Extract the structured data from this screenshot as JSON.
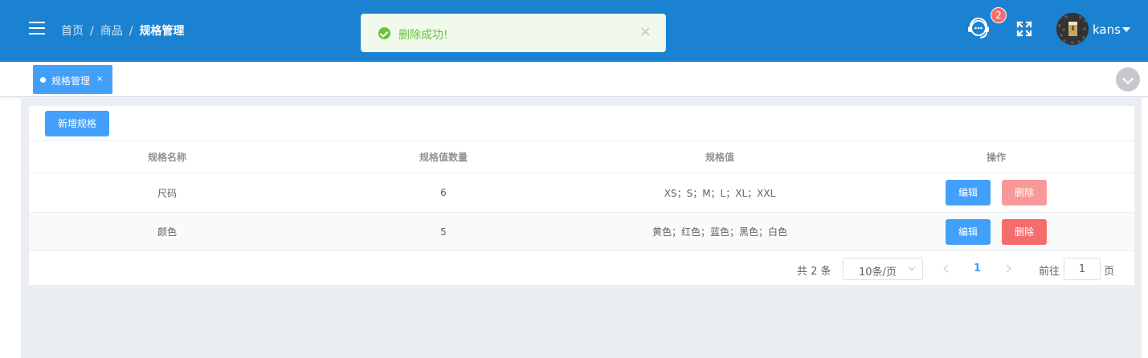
{
  "header": {
    "breadcrumb": [
      "首页",
      "商品",
      "规格管理"
    ],
    "separator": "/",
    "notification_count": "2",
    "user": {
      "name": "kans"
    },
    "colors": {
      "background": "#1b82d2"
    }
  },
  "toast": {
    "type": "success",
    "message": "删除成功!",
    "close": "×"
  },
  "tags": [
    {
      "label": "规格管理",
      "close": "×",
      "active": true
    }
  ],
  "toolbar": {
    "add_label": "新增规格"
  },
  "table": {
    "columns": [
      "规格名称",
      "规格值数量",
      "规格值",
      "操作"
    ],
    "rows": [
      {
        "name": "尺码",
        "count": "6",
        "values": "XS；S；M；L；XL；XXL"
      },
      {
        "name": "颜色",
        "count": "5",
        "values": "黄色；红色；蓝色；黑色；白色"
      }
    ],
    "actions": {
      "edit": "编辑",
      "delete": "删除"
    }
  },
  "pagination": {
    "total_text": "共 2 条",
    "page_size": "10条/页",
    "current_page": "1",
    "goto_label": "前往",
    "goto_value": "1",
    "goto_unit": "页"
  }
}
